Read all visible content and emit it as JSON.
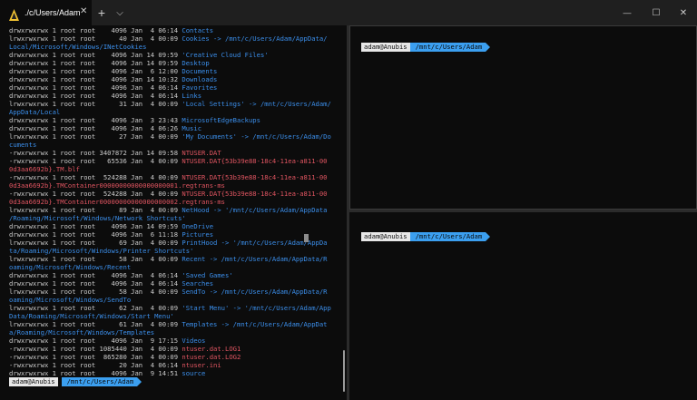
{
  "window": {
    "tab_title": "./c/Users/Adam",
    "tab_close": "✕",
    "new_tab": "+",
    "dropdown": "⌵",
    "minimize": "—",
    "maximize": "☐",
    "close": "✕"
  },
  "icons": {
    "tab": "linux-penguin-icon",
    "new_tab": "plus-icon",
    "dropdown": "chevron-down-icon",
    "minimize": "minimize-icon",
    "maximize": "maximize-icon",
    "close": "close-icon"
  },
  "colors": {
    "background": "#0c0c0c",
    "titlebar": "#1f1f1f",
    "text": "#cccccc",
    "link": "#3b8eea",
    "red": "#e05561",
    "prompt_user_bg": "#e8e8e8",
    "prompt_path_bg": "#3b9ff0"
  },
  "left_pane": {
    "lines": [
      {
        "meta": "drwxrwxrwx 1 root root    4096 Jan  4 06:14 ",
        "name": "Contacts",
        "color": "cyan"
      },
      {
        "meta": "lrwxrwxrwx 1 root root      40 Jan  4 00:09 ",
        "name": "Cookies -> /mnt/c/Users/Adam/AppData/",
        "color": "cyan"
      },
      {
        "meta": "",
        "name": "Local/Microsoft/Windows/INetCookies",
        "color": "cyan"
      },
      {
        "meta": "drwxrwxrwx 1 root root    4096 Jan 14 09:59 ",
        "name": "'Creative Cloud Files'",
        "color": "cyan"
      },
      {
        "meta": "drwxrwxrwx 1 root root    4096 Jan 14 09:59 ",
        "name": "Desktop",
        "color": "cyan"
      },
      {
        "meta": "drwxrwxrwx 1 root root    4096 Jan  6 12:00 ",
        "name": "Documents",
        "color": "cyan"
      },
      {
        "meta": "drwxrwxrwx 1 root root    4096 Jan 14 10:32 ",
        "name": "Downloads",
        "color": "cyan"
      },
      {
        "meta": "drwxrwxrwx 1 root root    4096 Jan  4 06:14 ",
        "name": "Favorites",
        "color": "cyan"
      },
      {
        "meta": "drwxrwxrwx 1 root root    4096 Jan  4 06:14 ",
        "name": "Links",
        "color": "cyan"
      },
      {
        "meta": "lrwxrwxrwx 1 root root      31 Jan  4 00:09 ",
        "name": "'Local Settings' -> /mnt/c/Users/Adam/",
        "color": "cyan"
      },
      {
        "meta": "",
        "name": "AppData/Local",
        "color": "cyan"
      },
      {
        "meta": "drwxrwxrwx 1 root root    4096 Jan  3 23:43 ",
        "name": "MicrosoftEdgeBackups",
        "color": "cyan"
      },
      {
        "meta": "drwxrwxrwx 1 root root    4096 Jan  4 06:26 ",
        "name": "Music",
        "color": "cyan"
      },
      {
        "meta": "lrwxrwxrwx 1 root root      27 Jan  4 00:09 ",
        "name": "'My Documents' -> /mnt/c/Users/Adam/Do",
        "color": "cyan"
      },
      {
        "meta": "",
        "name": "cuments",
        "color": "cyan"
      },
      {
        "meta": "-rwxrwxrwx 1 root root 3407872 Jan 14 09:58 ",
        "name": "NTUSER.DAT",
        "color": "red"
      },
      {
        "meta": "-rwxrwxrwx 1 root root   65536 Jan  4 00:09 ",
        "name": "NTUSER.DAT{53b39e88-18c4-11ea-a811-00",
        "color": "red"
      },
      {
        "meta": "",
        "name": "0d3aa6692b}.TM.blf",
        "color": "red"
      },
      {
        "meta": "-rwxrwxrwx 1 root root  524288 Jan  4 00:09 ",
        "name": "NTUSER.DAT{53b39e88-18c4-11ea-a811-00",
        "color": "red"
      },
      {
        "meta": "",
        "name": "0d3aa6692b}.TMContainer00000000000000000001.regtrans-ms",
        "color": "red"
      },
      {
        "meta": "-rwxrwxrwx 1 root root  524288 Jan  4 00:09 ",
        "name": "NTUSER.DAT{53b39e88-18c4-11ea-a811-00",
        "color": "red"
      },
      {
        "meta": "",
        "name": "0d3aa6692b}.TMContainer00000000000000000002.regtrans-ms",
        "color": "red"
      },
      {
        "meta": "lrwxrwxrwx 1 root root      89 Jan  4 00:09 ",
        "name": "NetHood -> '/mnt/c/Users/Adam/AppData",
        "color": "cyan"
      },
      {
        "meta": "",
        "name": "/Roaming/Microsoft/Windows/Network Shortcuts'",
        "color": "cyan"
      },
      {
        "meta": "drwxrwxrwx 1 root root    4096 Jan 14 09:59 ",
        "name": "OneDrive",
        "color": "cyan"
      },
      {
        "meta": "drwxrwxrwx 1 root root    4096 Jan  6 11:18 ",
        "name": "Pictures",
        "color": "cyan"
      },
      {
        "meta": "lrwxrwxrwx 1 root root      69 Jan  4 00:09 ",
        "name": "PrintHood -> '/mnt/c/Users/Adam/AppDa",
        "color": "cyan"
      },
      {
        "meta": "",
        "name": "ta/Roaming/Microsoft/Windows/Printer Shortcuts'",
        "color": "cyan"
      },
      {
        "meta": "lrwxrwxrwx 1 root root      58 Jan  4 00:09 ",
        "name": "Recent -> /mnt/c/Users/Adam/AppData/R",
        "color": "cyan"
      },
      {
        "meta": "",
        "name": "oaming/Microsoft/Windows/Recent",
        "color": "cyan"
      },
      {
        "meta": "drwxrwxrwx 1 root root    4096 Jan  4 06:14 ",
        "name": "'Saved Games'",
        "color": "cyan"
      },
      {
        "meta": "drwxrwxrwx 1 root root    4096 Jan  4 06:14 ",
        "name": "Searches",
        "color": "cyan"
      },
      {
        "meta": "lrwxrwxrwx 1 root root      58 Jan  4 00:09 ",
        "name": "SendTo -> /mnt/c/Users/Adam/AppData/R",
        "color": "cyan"
      },
      {
        "meta": "",
        "name": "oaming/Microsoft/Windows/SendTo",
        "color": "cyan"
      },
      {
        "meta": "lrwxrwxrwx 1 root root      62 Jan  4 00:09 ",
        "name": "'Start Menu' -> '/mnt/c/Users/Adam/App",
        "color": "cyan"
      },
      {
        "meta": "",
        "name": "Data/Roaming/Microsoft/Windows/Start Menu'",
        "color": "cyan"
      },
      {
        "meta": "lrwxrwxrwx 1 root root      61 Jan  4 00:09 ",
        "name": "Templates -> /mnt/c/Users/Adam/AppDat",
        "color": "cyan"
      },
      {
        "meta": "",
        "name": "a/Roaming/Microsoft/Windows/Templates",
        "color": "cyan"
      },
      {
        "meta": "drwxrwxrwx 1 root root    4096 Jan  9 17:15 ",
        "name": "Videos",
        "color": "cyan"
      },
      {
        "meta": "-rwxrwxrwx 1 root root 1085440 Jan  4 00:09 ",
        "name": "ntuser.dat.LOG1",
        "color": "red"
      },
      {
        "meta": "-rwxrwxrwx 1 root root  865280 Jan  4 00:09 ",
        "name": "ntuser.dat.LOG2",
        "color": "red"
      },
      {
        "meta": "-rwxrwxrwx 1 root root      20 Jan  4 06:14 ",
        "name": "ntuser.ini",
        "color": "red"
      },
      {
        "meta": "drwxrwxrwx 1 root root    4096 Jan  9 14:51 ",
        "name": "source",
        "color": "cyan"
      }
    ],
    "prompt_user": "adam@Anubis",
    "prompt_path": "/mnt/c/Users/Adam"
  },
  "right_top_pane": {
    "prompt_user": "adam@Anubis",
    "prompt_path": "/mnt/c/Users/Adam"
  },
  "right_bottom_pane": {
    "prompt_user": "adam@Anubis",
    "prompt_path": "/mnt/c/Users/Adam"
  }
}
